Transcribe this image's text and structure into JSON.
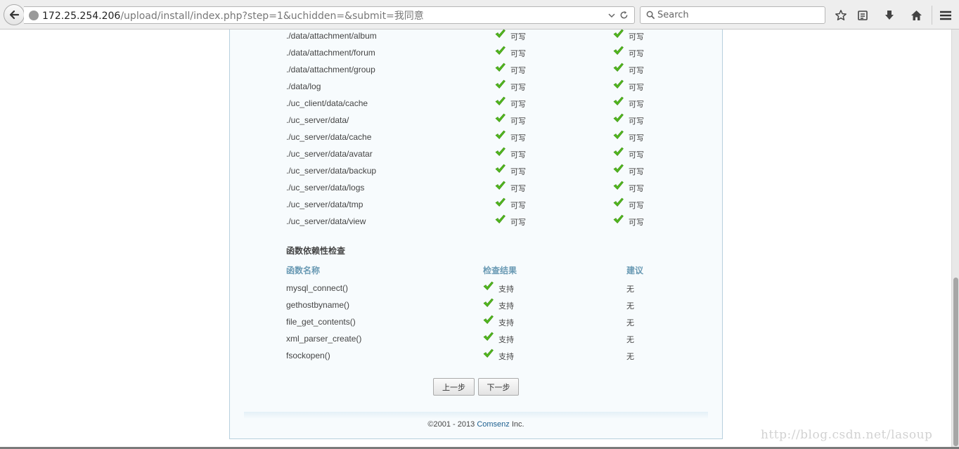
{
  "browser": {
    "url_host": "172.25.254.206",
    "url_path": "/upload/install/index.php?step=1&uchidden=&submit=我同意",
    "search_placeholder": "Search"
  },
  "dirs": [
    {
      "path": "./data/attachment/album",
      "current": "可写",
      "required": "可写"
    },
    {
      "path": "./data/attachment/forum",
      "current": "可写",
      "required": "可写"
    },
    {
      "path": "./data/attachment/group",
      "current": "可写",
      "required": "可写"
    },
    {
      "path": "./data/log",
      "current": "可写",
      "required": "可写"
    },
    {
      "path": "./uc_client/data/cache",
      "current": "可写",
      "required": "可写"
    },
    {
      "path": "./uc_server/data/",
      "current": "可写",
      "required": "可写"
    },
    {
      "path": "./uc_server/data/cache",
      "current": "可写",
      "required": "可写"
    },
    {
      "path": "./uc_server/data/avatar",
      "current": "可写",
      "required": "可写"
    },
    {
      "path": "./uc_server/data/backup",
      "current": "可写",
      "required": "可写"
    },
    {
      "path": "./uc_server/data/logs",
      "current": "可写",
      "required": "可写"
    },
    {
      "path": "./uc_server/data/tmp",
      "current": "可写",
      "required": "可写"
    },
    {
      "path": "./uc_server/data/view",
      "current": "可写",
      "required": "可写"
    }
  ],
  "func_check": {
    "title": "函数依赖性检查",
    "headers": {
      "name": "函数名称",
      "result": "检查结果",
      "advice": "建议"
    },
    "rows": [
      {
        "name": "mysql_connect()",
        "result": "支持",
        "advice": "无"
      },
      {
        "name": "gethostbyname()",
        "result": "支持",
        "advice": "无"
      },
      {
        "name": "file_get_contents()",
        "result": "支持",
        "advice": "无"
      },
      {
        "name": "xml_parser_create()",
        "result": "支持",
        "advice": "无"
      },
      {
        "name": "fsockopen()",
        "result": "支持",
        "advice": "无"
      }
    ]
  },
  "buttons": {
    "prev": "上一步",
    "next": "下一步"
  },
  "footer": {
    "prefix": "©2001 - 2013 ",
    "brand": "Comsenz",
    "suffix": " Inc."
  },
  "watermark": "http://blog.csdn.net/lasoup",
  "colors": {
    "check": "#52b81e",
    "header_blue": "#6a9ab4",
    "brand_link": "#1c5f8f"
  }
}
